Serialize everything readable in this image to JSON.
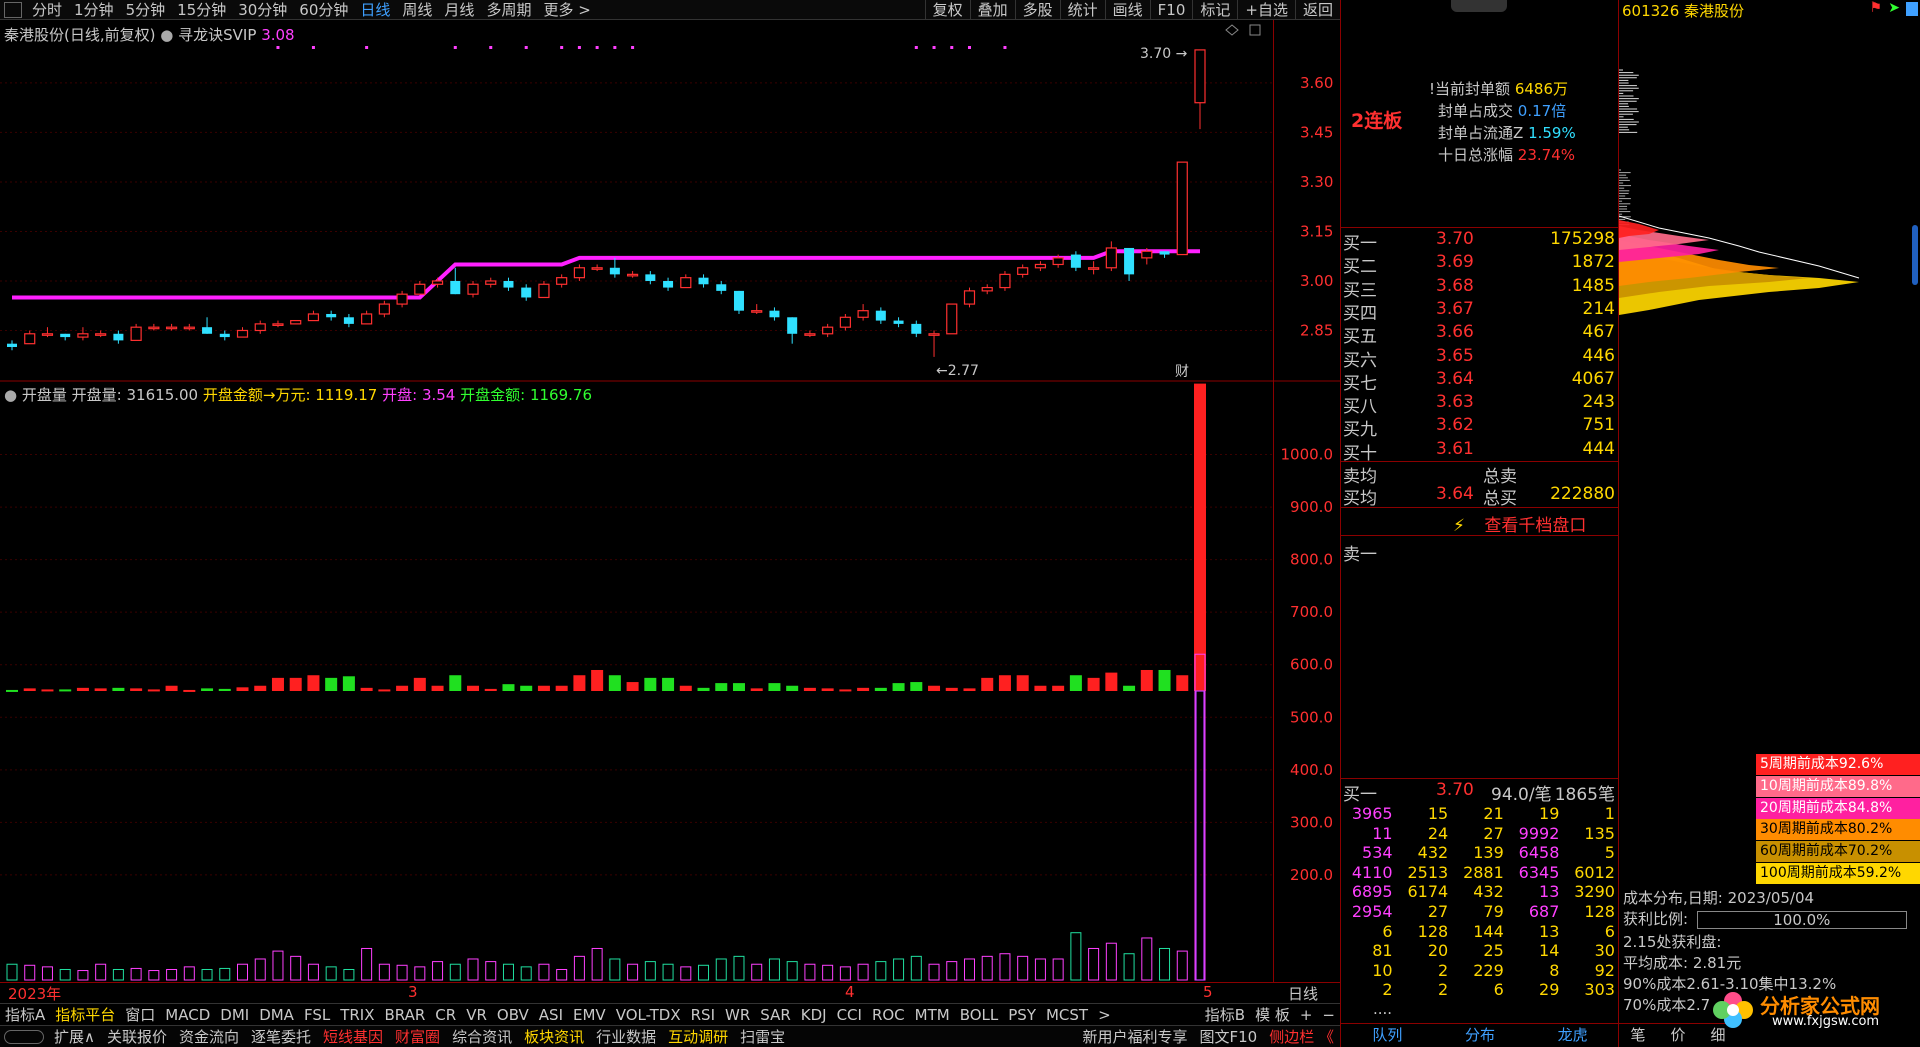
{
  "topbar": {
    "timeframes": [
      "分时",
      "1分钟",
      "5分钟",
      "15分钟",
      "30分钟",
      "60分钟",
      "日线",
      "周线",
      "月线",
      "多周期",
      "更多 >"
    ],
    "active_timeframe": "日线",
    "right_tools": [
      "复权",
      "叠加",
      "多股",
      "统计",
      "画线",
      "F10",
      "标记",
      "+自选",
      "返回"
    ]
  },
  "main": {
    "title": "秦港股份(日线,前复权)",
    "indicator_name": "寻龙诀SVIP",
    "indicator_value": "3.08",
    "high_label": "3.70",
    "low_label": "2.77",
    "badge": "财"
  },
  "volume_panel": {
    "name": "开盘量",
    "open_vol_label": "开盘量:",
    "open_vol": "31615.00",
    "open_amt_label": "开盘金额→万元:",
    "open_amt": "1119.17",
    "open_label": "开盘:",
    "open_price": "3.54",
    "open_amt2_label": "开盘金额:",
    "open_amt2": "1169.76"
  },
  "xaxis": {
    "labels": [
      "2023年",
      "3",
      "4",
      "5"
    ],
    "period": "日线"
  },
  "bottom_tabs": [
    "指标A",
    "指标平台",
    "窗口",
    "MACD",
    "DMI",
    "DMA",
    "FSL",
    "TRIX",
    "BRAR",
    "CR",
    "VR",
    "OBV",
    "ASI",
    "EMV",
    "VOL-TDX",
    "RSI",
    "WR",
    "SAR",
    "KDJ",
    "CCI",
    "ROC",
    "MTM",
    "BOLL",
    "PSY",
    "MCST",
    ">"
  ],
  "bottom_tabs_right": [
    "指标B",
    "模 板",
    "+",
    "−"
  ],
  "bottom_bar": [
    "扩展∧",
    "关联报价",
    "资金流向",
    "逐笔委托",
    "短线基因",
    "财富圈",
    "综合资讯",
    "板块资讯",
    "行业数据",
    "互动调研",
    "扫雷宝"
  ],
  "bottom_bar_right": [
    "新用户福利专享",
    "图文F10",
    "侧边栏 《"
  ],
  "order": {
    "streak": "2连板",
    "seal_amount_label": "当前封单额",
    "seal_amount": "6486万",
    "seal_ratio_label": "封单占成交",
    "seal_ratio": "0.17倍",
    "seal_float_label": "封单占流通Z",
    "seal_float": "1.59%",
    "ten_day_label": "十日总涨幅",
    "ten_day": "23.74%",
    "bids": [
      {
        "label": "买一",
        "price": "3.70",
        "vol": "175298"
      },
      {
        "label": "买二",
        "price": "3.69",
        "vol": "1872"
      },
      {
        "label": "买三",
        "price": "3.68",
        "vol": "1485"
      },
      {
        "label": "买四",
        "price": "3.67",
        "vol": "214"
      },
      {
        "label": "买五",
        "price": "3.66",
        "vol": "467"
      },
      {
        "label": "买六",
        "price": "3.65",
        "vol": "446"
      },
      {
        "label": "买七",
        "price": "3.64",
        "vol": "4067"
      },
      {
        "label": "买八",
        "price": "3.63",
        "vol": "243"
      },
      {
        "label": "买九",
        "price": "3.62",
        "vol": "751"
      },
      {
        "label": "买十",
        "price": "3.61",
        "vol": "444"
      }
    ],
    "sell_avg_label": "卖均",
    "total_sell_label": "总卖",
    "buy_avg_label": "买均",
    "buy_avg": "3.64",
    "total_buy_label": "总买",
    "total_buy": "222880",
    "view_thousand": "查看千档盘口",
    "sell_one": "卖一",
    "queue_label": "买一",
    "queue_price": "3.70",
    "queue_avg": "94.0/笔",
    "queue_count": "1865笔",
    "queue": [
      [
        "3965",
        "15",
        "21",
        "19",
        "1"
      ],
      [
        "11",
        "24",
        "27",
        "9992",
        "135"
      ],
      [
        "534",
        "432",
        "139",
        "6458",
        "5"
      ],
      [
        "4110",
        "2513",
        "2881",
        "6345",
        "6012"
      ],
      [
        "6895",
        "6174",
        "432",
        "13",
        "3290"
      ],
      [
        "2954",
        "27",
        "79",
        "687",
        "128"
      ],
      [
        "6",
        "128",
        "144",
        "13",
        "6"
      ],
      [
        "81",
        "20",
        "25",
        "14",
        "30"
      ],
      [
        "10",
        "2",
        "229",
        "8",
        "92"
      ],
      [
        "2",
        "2",
        "6",
        "29",
        "303"
      ]
    ],
    "queue_more": "....",
    "tabs": [
      "队列",
      "分布",
      "龙虎"
    ]
  },
  "profile": {
    "code_name": "601326 秦港股份",
    "legend": [
      {
        "text": "5周期前成本92.6%",
        "color": "#ff2020"
      },
      {
        "text": "10周期前成本89.8%",
        "color": "#ff6a8a"
      },
      {
        "text": "20周期前成本84.8%",
        "color": "#ff20a0"
      },
      {
        "text": "30周期前成本80.2%",
        "color": "#ff8c00"
      },
      {
        "text": "60周期前成本70.2%",
        "color": "#c89000"
      },
      {
        "text": "100周期前成本59.2%",
        "color": "#ffd700"
      }
    ],
    "dist_label": "成本分布,日期:",
    "dist_date": "2023/05/04",
    "profit_label": "获利比例:",
    "profit_value": "100.0%",
    "profit_note": "2.15处获利盘:",
    "avg_cost": "平均成本: 2.81元",
    "cost90": "90%成本2.61-3.10集中13.2%",
    "cost70": "70%成本2.7",
    "tabs": [
      "笔",
      "价",
      "细"
    ],
    "logo": "分析家公式网",
    "logo_url": "www.fxjgsw.com"
  },
  "chart_data": [
    {
      "type": "candlestick",
      "title": "秦港股份(日线,前复权)",
      "y_ticks": [
        2.85,
        3.0,
        3.15,
        3.3,
        3.45,
        3.6
      ],
      "ylim": [
        2.7,
        3.73
      ],
      "candles": [
        [
          2.81,
          2.8,
          2.82,
          2.79
        ],
        [
          2.81,
          2.84,
          2.85,
          2.81
        ],
        [
          2.84,
          2.84,
          2.86,
          2.83
        ],
        [
          2.84,
          2.83,
          2.84,
          2.82
        ],
        [
          2.83,
          2.84,
          2.86,
          2.82
        ],
        [
          2.84,
          2.84,
          2.85,
          2.83
        ],
        [
          2.84,
          2.82,
          2.85,
          2.81
        ],
        [
          2.82,
          2.86,
          2.87,
          2.82
        ],
        [
          2.86,
          2.86,
          2.87,
          2.85
        ],
        [
          2.86,
          2.86,
          2.87,
          2.85
        ],
        [
          2.86,
          2.86,
          2.87,
          2.85
        ],
        [
          2.86,
          2.84,
          2.89,
          2.84
        ],
        [
          2.84,
          2.83,
          2.85,
          2.82
        ],
        [
          2.83,
          2.85,
          2.86,
          2.83
        ],
        [
          2.85,
          2.87,
          2.88,
          2.84
        ],
        [
          2.87,
          2.87,
          2.88,
          2.86
        ],
        [
          2.87,
          2.88,
          2.88,
          2.87
        ],
        [
          2.88,
          2.9,
          2.91,
          2.88
        ],
        [
          2.9,
          2.89,
          2.91,
          2.88
        ],
        [
          2.89,
          2.87,
          2.9,
          2.86
        ],
        [
          2.87,
          2.9,
          2.91,
          2.87
        ],
        [
          2.9,
          2.93,
          2.94,
          2.89
        ],
        [
          2.93,
          2.96,
          2.97,
          2.92
        ],
        [
          2.96,
          2.99,
          3.0,
          2.96
        ],
        [
          2.99,
          3.0,
          3.01,
          2.98
        ],
        [
          3.0,
          2.96,
          3.04,
          2.96
        ],
        [
          2.96,
          2.99,
          3.0,
          2.95
        ],
        [
          2.99,
          3.0,
          3.01,
          2.98
        ],
        [
          3.0,
          2.98,
          3.01,
          2.97
        ],
        [
          2.98,
          2.95,
          2.99,
          2.94
        ],
        [
          2.95,
          2.99,
          3.0,
          2.95
        ],
        [
          2.99,
          3.01,
          3.02,
          2.98
        ],
        [
          3.01,
          3.04,
          3.05,
          3.0
        ],
        [
          3.04,
          3.04,
          3.05,
          3.03
        ],
        [
          3.04,
          3.02,
          3.07,
          3.01
        ],
        [
          3.02,
          3.02,
          3.03,
          3.01
        ],
        [
          3.02,
          3.0,
          3.03,
          2.99
        ],
        [
          3.0,
          2.98,
          3.01,
          2.97
        ],
        [
          2.98,
          3.01,
          3.02,
          2.98
        ],
        [
          3.01,
          2.99,
          3.02,
          2.98
        ],
        [
          2.99,
          2.97,
          3.0,
          2.96
        ],
        [
          2.97,
          2.91,
          2.97,
          2.9
        ],
        [
          2.91,
          2.91,
          2.93,
          2.9
        ],
        [
          2.91,
          2.89,
          2.92,
          2.88
        ],
        [
          2.89,
          2.84,
          2.89,
          2.81
        ],
        [
          2.84,
          2.84,
          2.85,
          2.83
        ],
        [
          2.84,
          2.86,
          2.87,
          2.83
        ],
        [
          2.86,
          2.89,
          2.9,
          2.85
        ],
        [
          2.89,
          2.91,
          2.93,
          2.88
        ],
        [
          2.91,
          2.88,
          2.92,
          2.87
        ],
        [
          2.88,
          2.87,
          2.89,
          2.86
        ],
        [
          2.87,
          2.84,
          2.88,
          2.83
        ],
        [
          2.84,
          2.84,
          2.85,
          2.77
        ],
        [
          2.84,
          2.93,
          2.93,
          2.84
        ],
        [
          2.93,
          2.97,
          2.98,
          2.92
        ],
        [
          2.97,
          2.98,
          2.99,
          2.96
        ],
        [
          2.98,
          3.02,
          3.03,
          2.97
        ],
        [
          3.02,
          3.04,
          3.05,
          3.01
        ],
        [
          3.04,
          3.05,
          3.06,
          3.03
        ],
        [
          3.05,
          3.07,
          3.08,
          3.04
        ],
        [
          3.08,
          3.04,
          3.09,
          3.03
        ],
        [
          3.04,
          3.04,
          3.06,
          3.02
        ],
        [
          3.04,
          3.1,
          3.12,
          3.03
        ],
        [
          3.1,
          3.02,
          3.09,
          3.0
        ],
        [
          3.07,
          3.09,
          3.1,
          3.05
        ],
        [
          3.09,
          3.08,
          3.09,
          3.07
        ],
        [
          3.08,
          3.36,
          3.36,
          3.08
        ],
        [
          3.54,
          3.7,
          3.7,
          3.46
        ]
      ],
      "indicator_line": [
        [
          0,
          2.95
        ],
        [
          23,
          2.95
        ],
        [
          25,
          3.05
        ],
        [
          31,
          3.05
        ],
        [
          32,
          3.07
        ],
        [
          52,
          3.07
        ],
        [
          54,
          3.07
        ],
        [
          61,
          3.07
        ],
        [
          62,
          3.09
        ],
        [
          67,
          3.09
        ]
      ],
      "signal_dots": [
        15,
        17,
        20,
        25,
        27,
        29,
        31,
        32,
        33,
        34,
        35,
        51,
        52,
        53,
        54,
        56
      ]
    },
    {
      "type": "bar",
      "title": "开盘量",
      "y_ticks": [
        200,
        300,
        400,
        500,
        600,
        700,
        800,
        900,
        1000
      ],
      "ylim": [
        0,
        1100
      ],
      "threshold": 550,
      "values": [
        552,
        555,
        553,
        553,
        556,
        555,
        556,
        555,
        553,
        560,
        552,
        555,
        554,
        557,
        560,
        575,
        575,
        580,
        575,
        578,
        556,
        553,
        560,
        575,
        560,
        580,
        560,
        554,
        563,
        560,
        560,
        560,
        580,
        590,
        580,
        567,
        575,
        575,
        560,
        556,
        565,
        565,
        555,
        565,
        560,
        556,
        555,
        553,
        556,
        556,
        565,
        567,
        560,
        556,
        555,
        575,
        580,
        580,
        560,
        560,
        580,
        575,
        585,
        560,
        590,
        590,
        580,
        1135
      ],
      "small_values": [
        30,
        28,
        25,
        20,
        18,
        30,
        20,
        22,
        18,
        20,
        25,
        20,
        22,
        30,
        40,
        55,
        45,
        30,
        25,
        20,
        60,
        30,
        28,
        25,
        35,
        30,
        40,
        35,
        30,
        25,
        30,
        20,
        45,
        60,
        40,
        30,
        35,
        30,
        25,
        28,
        40,
        45,
        30,
        40,
        35,
        30,
        28,
        25,
        30,
        35,
        40,
        45,
        30,
        35,
        40,
        45,
        50,
        45,
        40,
        40,
        90,
        60,
        70,
        50,
        80,
        60,
        55,
        620
      ]
    }
  ]
}
